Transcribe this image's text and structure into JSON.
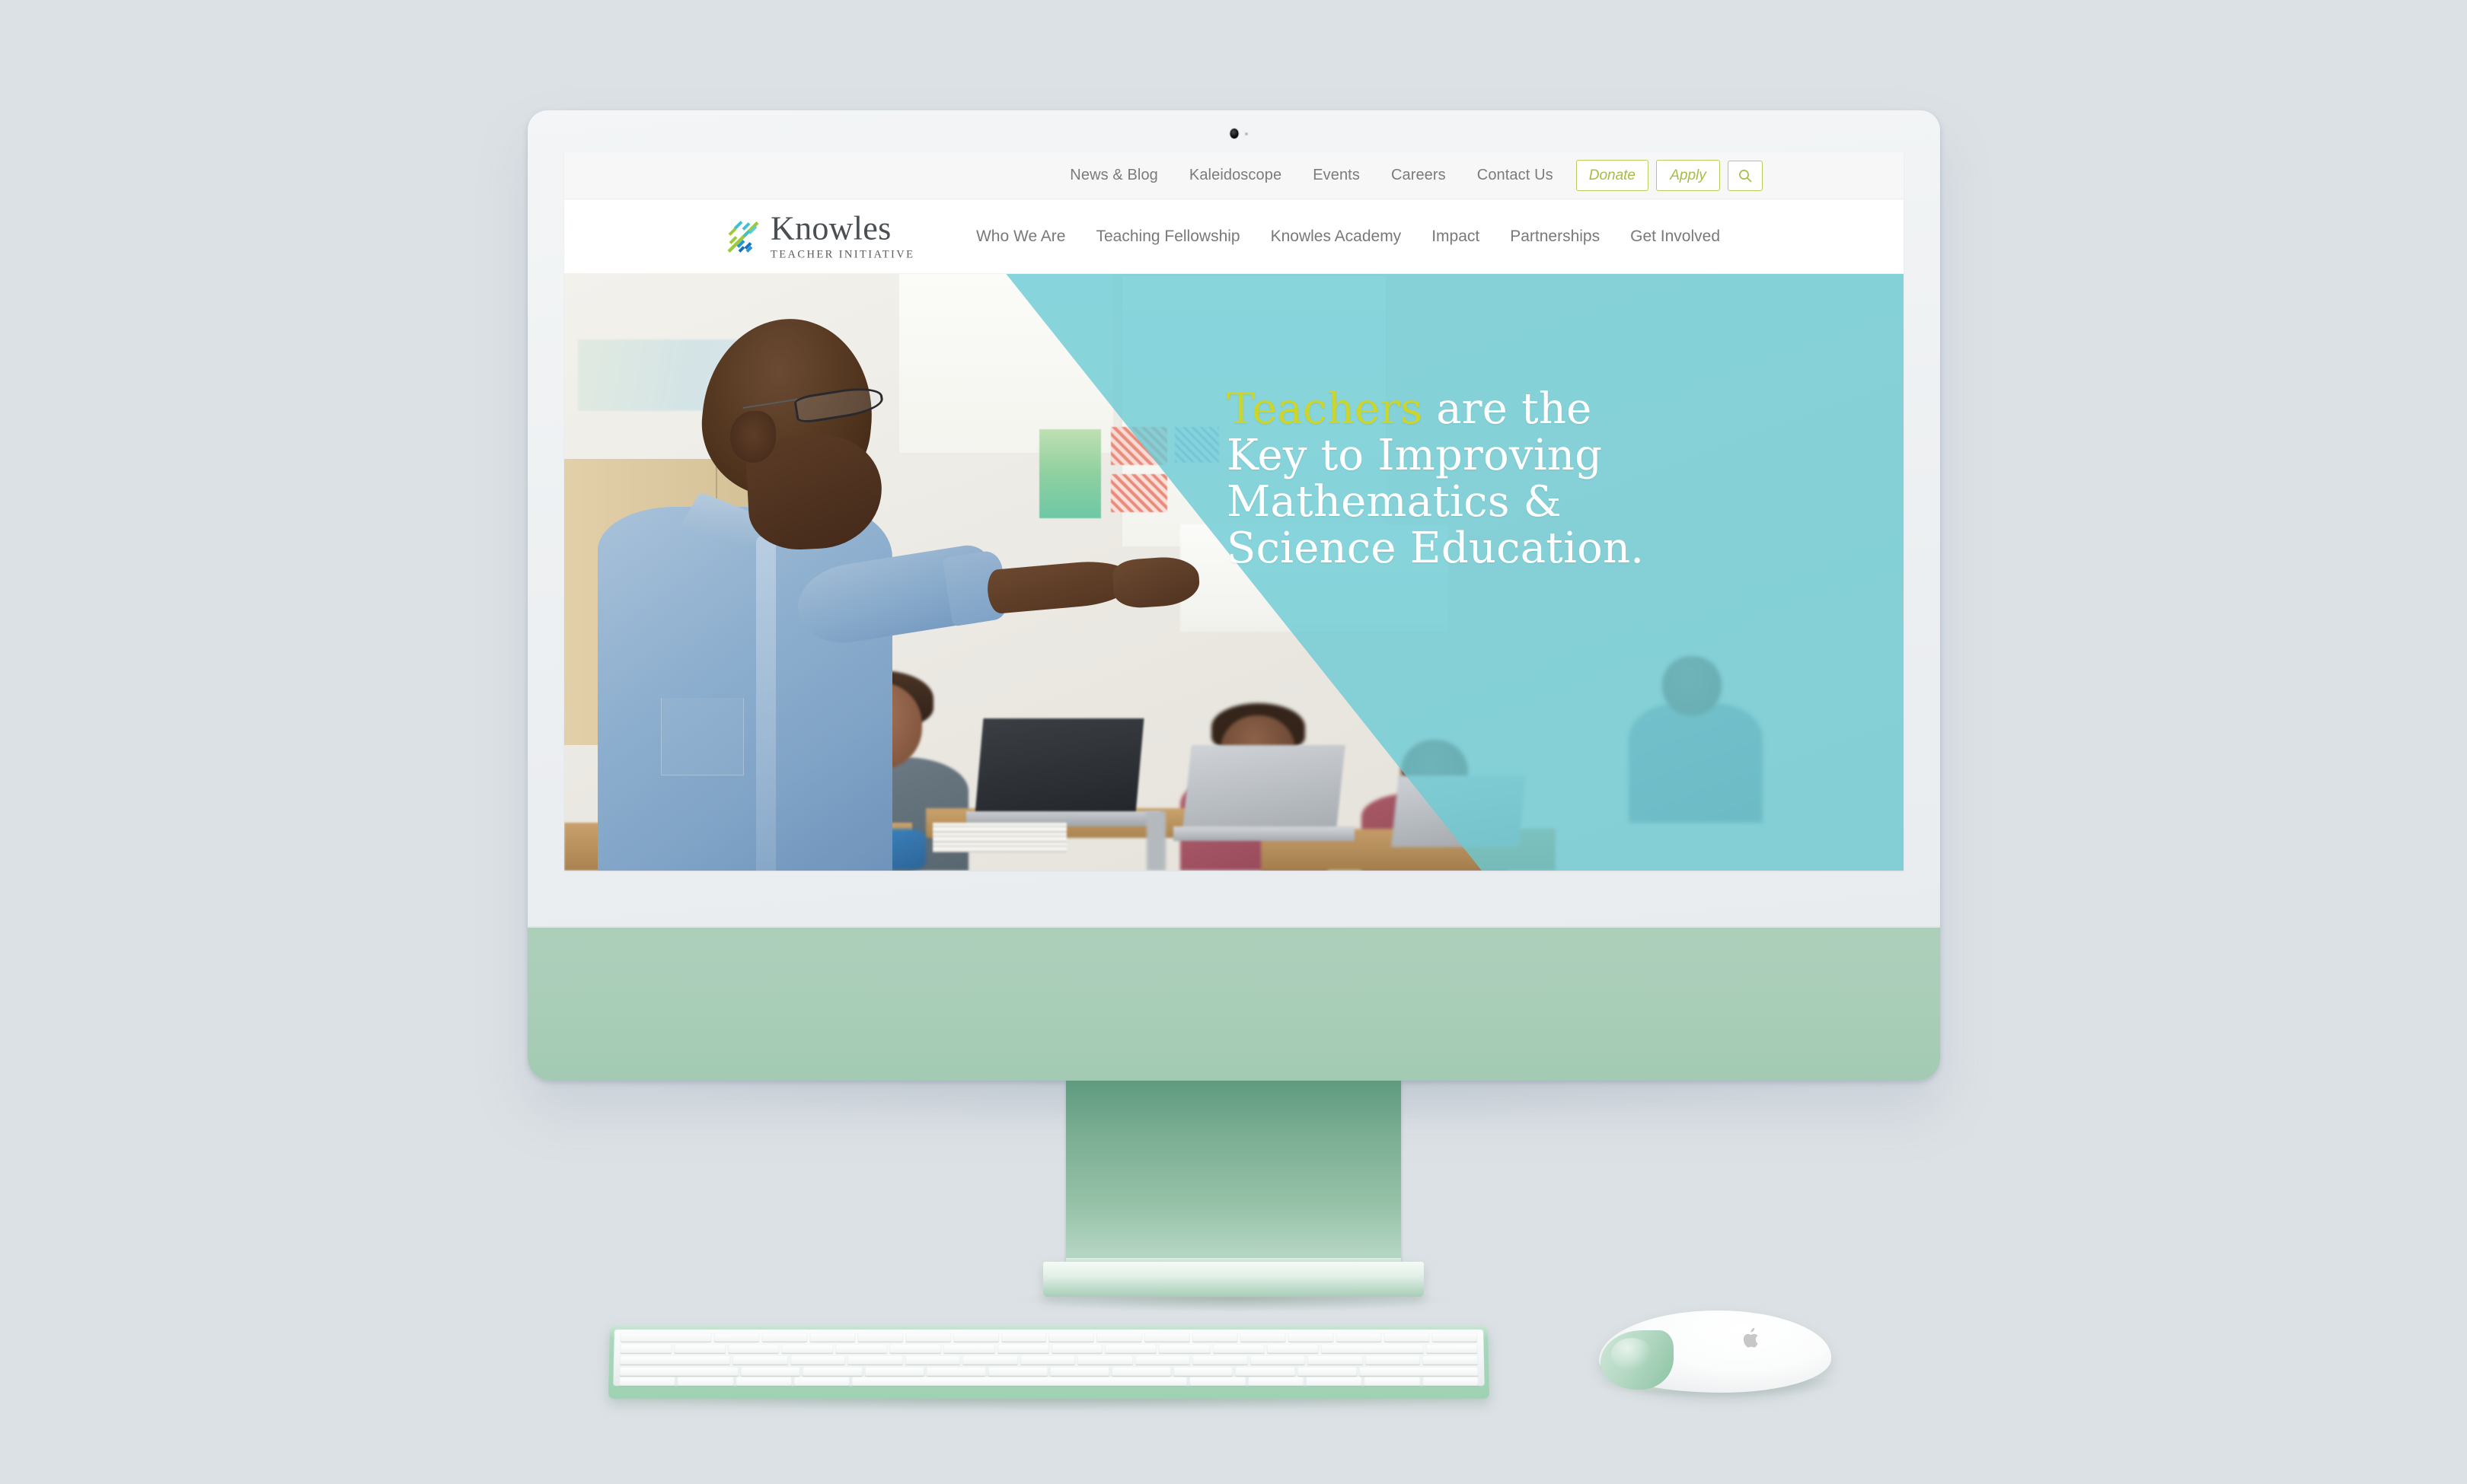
{
  "device": {
    "type": "desktop-computer-mockup",
    "body_color": "#eff2f4",
    "chin_color": "#a9ceb8",
    "stand_color": "#79ad92",
    "accessories": [
      "keyboard",
      "mouse"
    ],
    "camera_label": "camera",
    "indicator_label": "status-indicator"
  },
  "page_background": "#dce1e5",
  "site": {
    "utility_nav": {
      "links": [
        {
          "label": "News & Blog"
        },
        {
          "label": "Kaleidoscope"
        },
        {
          "label": "Events"
        },
        {
          "label": "Careers"
        },
        {
          "label": "Contact Us"
        }
      ],
      "buttons": [
        {
          "label": "Donate",
          "name": "donate-button"
        },
        {
          "label": "Apply",
          "name": "apply-button"
        }
      ],
      "search": {
        "icon": "search-icon",
        "label": "Search"
      }
    },
    "brand": {
      "name": "Knowles",
      "tagline": "TEACHER INITIATIVE",
      "mark": "knowles-x-mark",
      "mark_colors": [
        "#9ec93a",
        "#41bfd0",
        "#2196d4",
        "#1b6fc0"
      ]
    },
    "main_nav": {
      "links": [
        {
          "label": "Who We Are"
        },
        {
          "label": "Teaching Fellowship"
        },
        {
          "label": "Knowles Academy"
        },
        {
          "label": "Impact"
        },
        {
          "label": "Partnerships"
        },
        {
          "label": "Get Involved"
        }
      ]
    },
    "hero": {
      "image_alt": "Teacher in a light blue shirt pointing while students work on laptops in a classroom",
      "overlay_color": "#6ccbd4",
      "headline_accent_word": "Teachers",
      "headline_accent_color": "#ccd62a",
      "headline_rest_line1": " are the",
      "headline_line2": "Key to Improving",
      "headline_line3": "Mathematics &",
      "headline_line4": "Science Education.",
      "headline_color": "#ffffff"
    }
  },
  "colors": {
    "brand_green": "#a3bd47",
    "brand_green_border": "#b5ce5d",
    "teal": "#6ccbd4",
    "accent_yellow_green": "#ccd62a",
    "nav_text": "#77797b",
    "utility_text": "#7b7b7b"
  }
}
